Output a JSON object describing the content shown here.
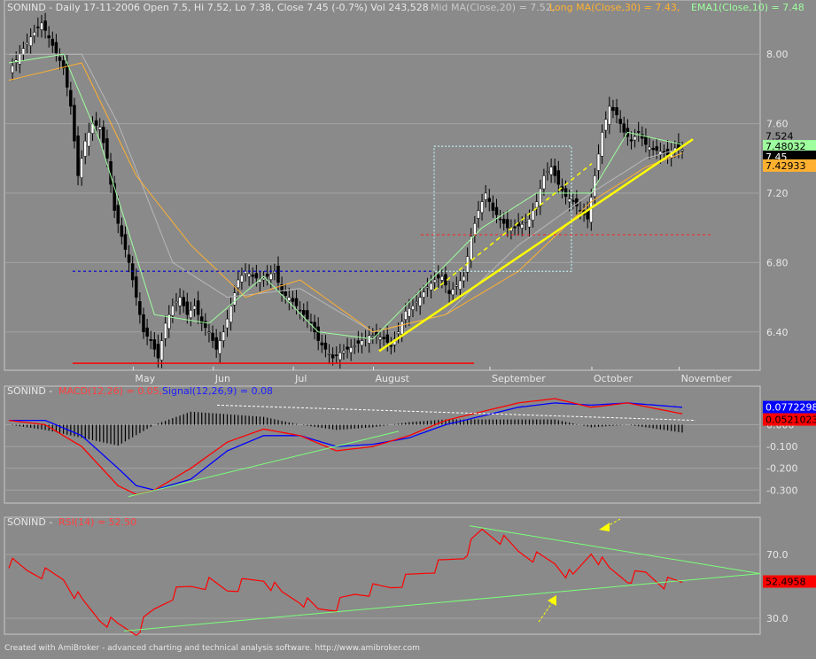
{
  "colors": {
    "background": "#8a8a8a",
    "panel_bg": "#8a8a8a",
    "grid": "#a3a3a3",
    "up_candle": "#ffffff",
    "down_candle": "#000000",
    "ma20": "#b8b8b8",
    "ma30": "#ffb030",
    "ema10": "#9eff9e",
    "macd": "#ff0000",
    "signal": "#0000ff",
    "rsi": "#ff0000",
    "trend_yellow": "#ffff00",
    "trend_green": "#7aff7a"
  },
  "price_panel": {
    "title": "SONIND - Daily 17-11-2006 Open 7.5, Hi 7.52, Lo 7.38, Close 7.45 (-0.7%) Vol 243,528",
    "ma20_label": "Mid MA(Close,20) = 7.52,",
    "ma30_label": "Long MA(Close,30) = 7.43,",
    "ema10_label": "EMA1(Close,10) = 7.48",
    "y_ticks": [
      "8.00",
      "7.60",
      "7.20",
      "6.80",
      "6.40"
    ],
    "last_values": {
      "high": "7.524",
      "ema": "7.48032",
      "close": "7.45",
      "ma30": "7.42933"
    },
    "months": [
      "May",
      "Jun",
      "Jul",
      "August",
      "September",
      "October",
      "November"
    ]
  },
  "macd_panel": {
    "title_prefix": "SONIND - ",
    "macd_label": "MACD(12,26) = 0.05,",
    "signal_label": "Signal(12,26,9) = 0.08",
    "y_ticks": [
      "0.000",
      "-0.100",
      "-0.200",
      "-0.300"
    ],
    "last_values": {
      "signal": "0.0772298",
      "macd": "0.0521023"
    }
  },
  "rsi_panel": {
    "title_prefix": "SONIND - ",
    "rsi_label": "RSI(14) = 52.50",
    "y_ticks": [
      "70.0",
      "30.0"
    ],
    "last_value": "52.4958"
  },
  "footer": "Created with AmiBroker - advanced charting and technical analysis software. http://www.amibroker.com",
  "chart_data": {
    "type": "candlestick",
    "title": "SONIND - Daily 17-11-2006",
    "x_months": [
      "May",
      "Jun",
      "Jul",
      "August",
      "September",
      "October",
      "November"
    ],
    "price_ylim": [
      6.2,
      8.2
    ],
    "close_path": [
      [
        0,
        7.9
      ],
      [
        3,
        8.0
      ],
      [
        6,
        8.1
      ],
      [
        9,
        8.18
      ],
      [
        12,
        8.05
      ],
      [
        15,
        7.92
      ],
      [
        17,
        7.7
      ],
      [
        19,
        7.3
      ],
      [
        21,
        7.5
      ],
      [
        23,
        7.6
      ],
      [
        25,
        7.58
      ],
      [
        27,
        7.4
      ],
      [
        29,
        7.1
      ],
      [
        31,
        6.95
      ],
      [
        33,
        6.8
      ],
      [
        35,
        6.6
      ],
      [
        37,
        6.4
      ],
      [
        39,
        6.35
      ],
      [
        41,
        6.25
      ],
      [
        43,
        6.45
      ],
      [
        45,
        6.55
      ],
      [
        47,
        6.6
      ],
      [
        49,
        6.5
      ],
      [
        51,
        6.55
      ],
      [
        53,
        6.45
      ],
      [
        55,
        6.4
      ],
      [
        57,
        6.3
      ],
      [
        59,
        6.4
      ],
      [
        61,
        6.55
      ],
      [
        63,
        6.7
      ],
      [
        65,
        6.75
      ],
      [
        67,
        6.72
      ],
      [
        69,
        6.7
      ],
      [
        71,
        6.72
      ],
      [
        73,
        6.75
      ],
      [
        75,
        6.62
      ],
      [
        77,
        6.6
      ],
      [
        79,
        6.55
      ],
      [
        81,
        6.5
      ],
      [
        83,
        6.45
      ],
      [
        85,
        6.35
      ],
      [
        87,
        6.3
      ],
      [
        89,
        6.25
      ],
      [
        91,
        6.28
      ],
      [
        93,
        6.3
      ],
      [
        95,
        6.32
      ],
      [
        97,
        6.35
      ],
      [
        99,
        6.38
      ],
      [
        101,
        6.38
      ],
      [
        103,
        6.36
      ],
      [
        105,
        6.32
      ],
      [
        107,
        6.4
      ],
      [
        109,
        6.52
      ],
      [
        111,
        6.55
      ],
      [
        113,
        6.6
      ],
      [
        115,
        6.66
      ],
      [
        117,
        6.7
      ],
      [
        119,
        6.72
      ],
      [
        121,
        6.62
      ],
      [
        123,
        6.67
      ],
      [
        125,
        6.72
      ],
      [
        127,
        6.95
      ],
      [
        129,
        7.1
      ],
      [
        131,
        7.2
      ],
      [
        133,
        7.1
      ],
      [
        135,
        7.05
      ],
      [
        137,
        7.0
      ],
      [
        139,
        7.0
      ],
      [
        141,
        7.02
      ],
      [
        143,
        7.05
      ],
      [
        145,
        7.15
      ],
      [
        147,
        7.3
      ],
      [
        149,
        7.35
      ],
      [
        151,
        7.25
      ],
      [
        153,
        7.18
      ],
      [
        155,
        7.15
      ],
      [
        157,
        7.1
      ],
      [
        159,
        7.05
      ],
      [
        161,
        7.3
      ],
      [
        163,
        7.55
      ],
      [
        165,
        7.7
      ],
      [
        167,
        7.65
      ],
      [
        169,
        7.55
      ],
      [
        171,
        7.5
      ],
      [
        173,
        7.55
      ],
      [
        175,
        7.48
      ],
      [
        177,
        7.45
      ],
      [
        179,
        7.44
      ],
      [
        181,
        7.42
      ],
      [
        183,
        7.46
      ],
      [
        185,
        7.45
      ]
    ],
    "trend_ma20": [
      [
        0,
        8.0
      ],
      [
        20,
        8.0
      ],
      [
        30,
        7.6
      ],
      [
        45,
        6.8
      ],
      [
        60,
        6.6
      ],
      [
        80,
        6.65
      ],
      [
        100,
        6.4
      ],
      [
        120,
        6.5
      ],
      [
        140,
        6.9
      ],
      [
        160,
        7.2
      ],
      [
        175,
        7.4
      ],
      [
        185,
        7.46
      ]
    ],
    "trend_ma30": [
      [
        0,
        7.85
      ],
      [
        20,
        7.95
      ],
      [
        35,
        7.3
      ],
      [
        50,
        6.9
      ],
      [
        65,
        6.6
      ],
      [
        80,
        6.7
      ],
      [
        100,
        6.4
      ],
      [
        120,
        6.5
      ],
      [
        140,
        6.75
      ],
      [
        160,
        7.15
      ],
      [
        175,
        7.35
      ],
      [
        185,
        7.43
      ]
    ],
    "trend_ema10": [
      [
        0,
        7.95
      ],
      [
        15,
        8.0
      ],
      [
        25,
        7.5
      ],
      [
        40,
        6.5
      ],
      [
        55,
        6.45
      ],
      [
        70,
        6.72
      ],
      [
        85,
        6.4
      ],
      [
        100,
        6.36
      ],
      [
        115,
        6.68
      ],
      [
        130,
        7.0
      ],
      [
        145,
        7.2
      ],
      [
        160,
        7.2
      ],
      [
        170,
        7.55
      ],
      [
        185,
        7.48
      ]
    ],
    "support_lines": [
      {
        "name": "low",
        "value": 6.22
      },
      {
        "name": "mid",
        "value": 6.75
      },
      {
        "name": "high",
        "value": 6.96
      }
    ],
    "macd_series": {
      "macd": [
        [
          0,
          0.02
        ],
        [
          10,
          0.0
        ],
        [
          20,
          -0.1
        ],
        [
          30,
          -0.28
        ],
        [
          35,
          -0.32
        ],
        [
          40,
          -0.3
        ],
        [
          50,
          -0.2
        ],
        [
          60,
          -0.08
        ],
        [
          70,
          -0.02
        ],
        [
          80,
          -0.05
        ],
        [
          90,
          -0.12
        ],
        [
          100,
          -0.1
        ],
        [
          110,
          -0.05
        ],
        [
          120,
          0.02
        ],
        [
          130,
          0.06
        ],
        [
          140,
          0.1
        ],
        [
          150,
          0.12
        ],
        [
          160,
          0.08
        ],
        [
          170,
          0.1
        ],
        [
          185,
          0.05
        ]
      ],
      "signal": [
        [
          0,
          0.02
        ],
        [
          10,
          0.02
        ],
        [
          20,
          -0.05
        ],
        [
          30,
          -0.2
        ],
        [
          35,
          -0.28
        ],
        [
          40,
          -0.3
        ],
        [
          50,
          -0.25
        ],
        [
          60,
          -0.12
        ],
        [
          70,
          -0.05
        ],
        [
          80,
          -0.05
        ],
        [
          90,
          -0.1
        ],
        [
          100,
          -0.09
        ],
        [
          110,
          -0.06
        ],
        [
          120,
          0.0
        ],
        [
          130,
          0.04
        ],
        [
          140,
          0.08
        ],
        [
          150,
          0.1
        ],
        [
          160,
          0.09
        ],
        [
          170,
          0.1
        ],
        [
          185,
          0.08
        ]
      ]
    },
    "rsi_series": [
      [
        0,
        65
      ],
      [
        5,
        60
      ],
      [
        10,
        58
      ],
      [
        15,
        55
      ],
      [
        20,
        40
      ],
      [
        25,
        30
      ],
      [
        30,
        25
      ],
      [
        35,
        22
      ],
      [
        40,
        35
      ],
      [
        45,
        45
      ],
      [
        50,
        50
      ],
      [
        55,
        52
      ],
      [
        60,
        48
      ],
      [
        65,
        52
      ],
      [
        70,
        55
      ],
      [
        75,
        45
      ],
      [
        80,
        42
      ],
      [
        85,
        35
      ],
      [
        90,
        38
      ],
      [
        95,
        45
      ],
      [
        100,
        48
      ],
      [
        105,
        50
      ],
      [
        110,
        55
      ],
      [
        115,
        60
      ],
      [
        120,
        65
      ],
      [
        125,
        70
      ],
      [
        130,
        85
      ],
      [
        135,
        80
      ],
      [
        140,
        72
      ],
      [
        145,
        68
      ],
      [
        150,
        65
      ],
      [
        155,
        55
      ],
      [
        160,
        72
      ],
      [
        165,
        60
      ],
      [
        170,
        55
      ],
      [
        175,
        58
      ],
      [
        180,
        52
      ],
      [
        185,
        52.5
      ]
    ],
    "rsi_ylim": [
      20,
      90
    ]
  }
}
